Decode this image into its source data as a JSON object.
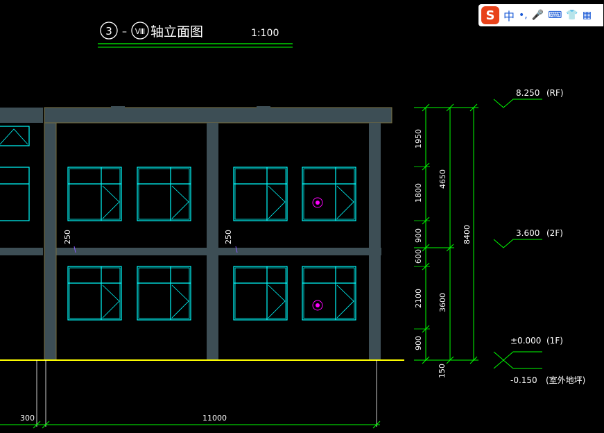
{
  "title": {
    "circle_a": "3",
    "dash": "–",
    "circle_b": "Ⅷ",
    "text": "轴立面图",
    "scale": "1:100"
  },
  "levels": [
    {
      "value": "8.250",
      "tag": "(RF)"
    },
    {
      "value": "3.600",
      "tag": "(2F)"
    },
    {
      "value": "±0.000",
      "tag": "(1F)"
    },
    {
      "value": "-0.150",
      "tag": "(室外地坪)"
    }
  ],
  "vertical_dims": {
    "inner": [
      "1950",
      "1800",
      "900",
      "600",
      "2100",
      "900",
      "150"
    ],
    "mid": [
      "4650",
      "3600"
    ],
    "outer": [
      "8400"
    ]
  },
  "beam_labels": [
    "250",
    "250"
  ],
  "horizontal_dims": [
    "300",
    "11000"
  ],
  "ime_toolbar": {
    "logo": "S",
    "mode": "中",
    "punct": "•,",
    "mic": "🎤",
    "keyboard": "⌨",
    "skin": "👕",
    "apps": "▦"
  },
  "colors": {
    "background": "#000000",
    "frame": "#3d4e55",
    "window": "#00ffff",
    "dimension": "#00ff00",
    "ground": "#ffff00",
    "text": "#ffffff",
    "marker": "#ff00ff"
  }
}
